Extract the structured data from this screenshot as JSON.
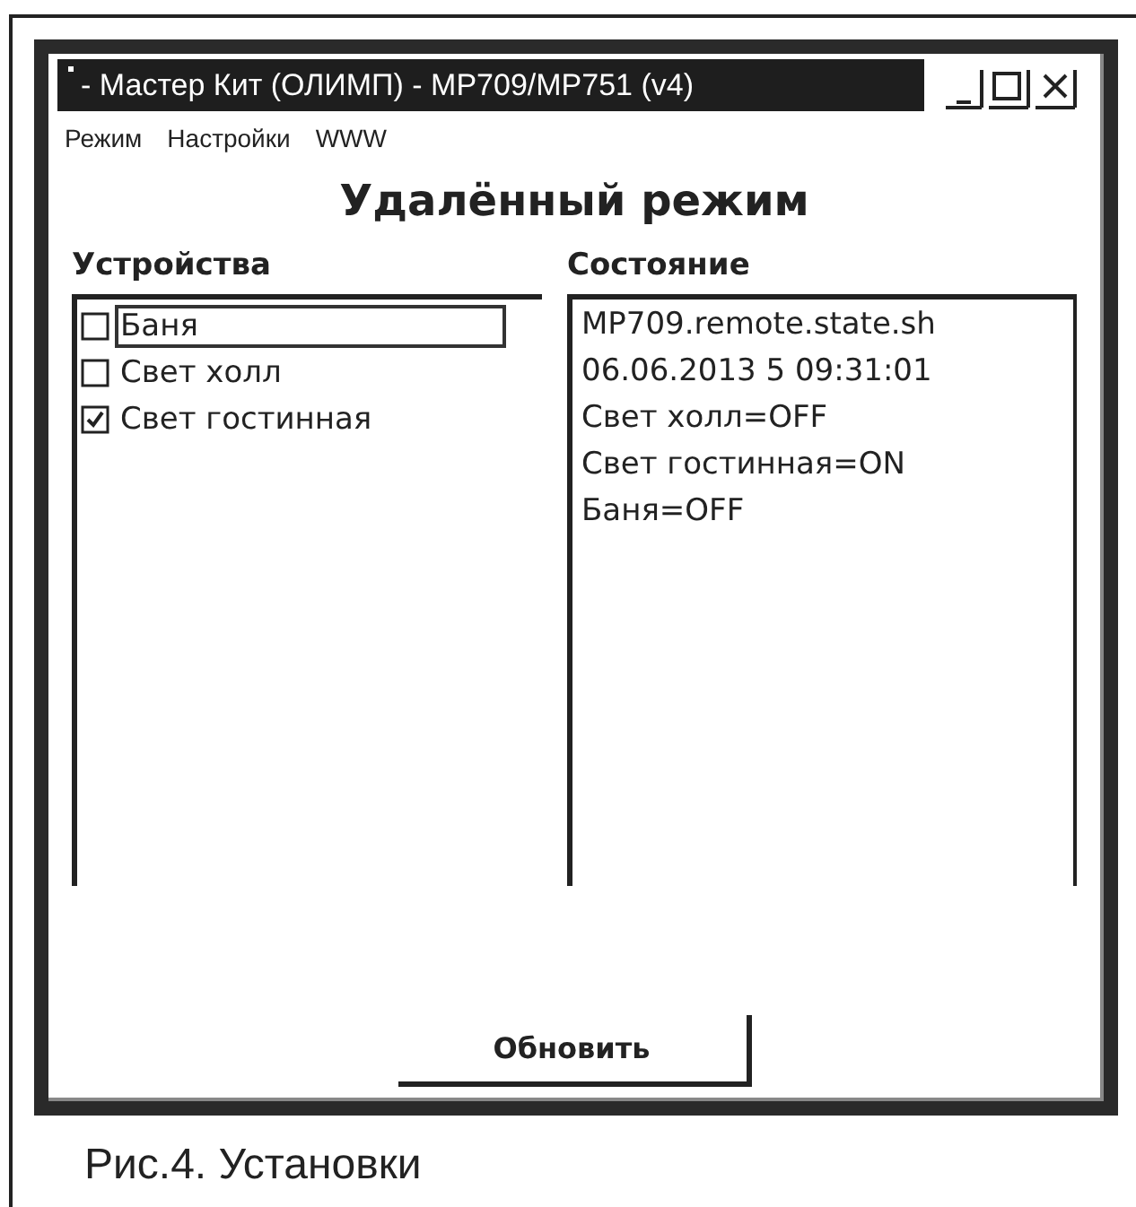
{
  "window": {
    "title": "- Мастер Кит (ОЛИМП) - MP709/MP751 (v4)"
  },
  "menu": [
    "Режим",
    "Настройки",
    "WWW"
  ],
  "heading": "Удалённый режим",
  "devices": {
    "label": "Устройства",
    "items": [
      {
        "label": "Баня",
        "checked": false,
        "selected": true
      },
      {
        "label": "Свет холл",
        "checked": false,
        "selected": false
      },
      {
        "label": "Свет гостинная",
        "checked": true,
        "selected": false
      }
    ]
  },
  "state": {
    "label": "Состояние",
    "lines": [
      "MP709.remote.state.sh",
      "06.06.2013 5 09:31:01",
      "Свет холл=OFF",
      "Свет гостинная=ON",
      "Баня=OFF"
    ]
  },
  "button": "Обновить",
  "caption": "Рис.4. Установки"
}
